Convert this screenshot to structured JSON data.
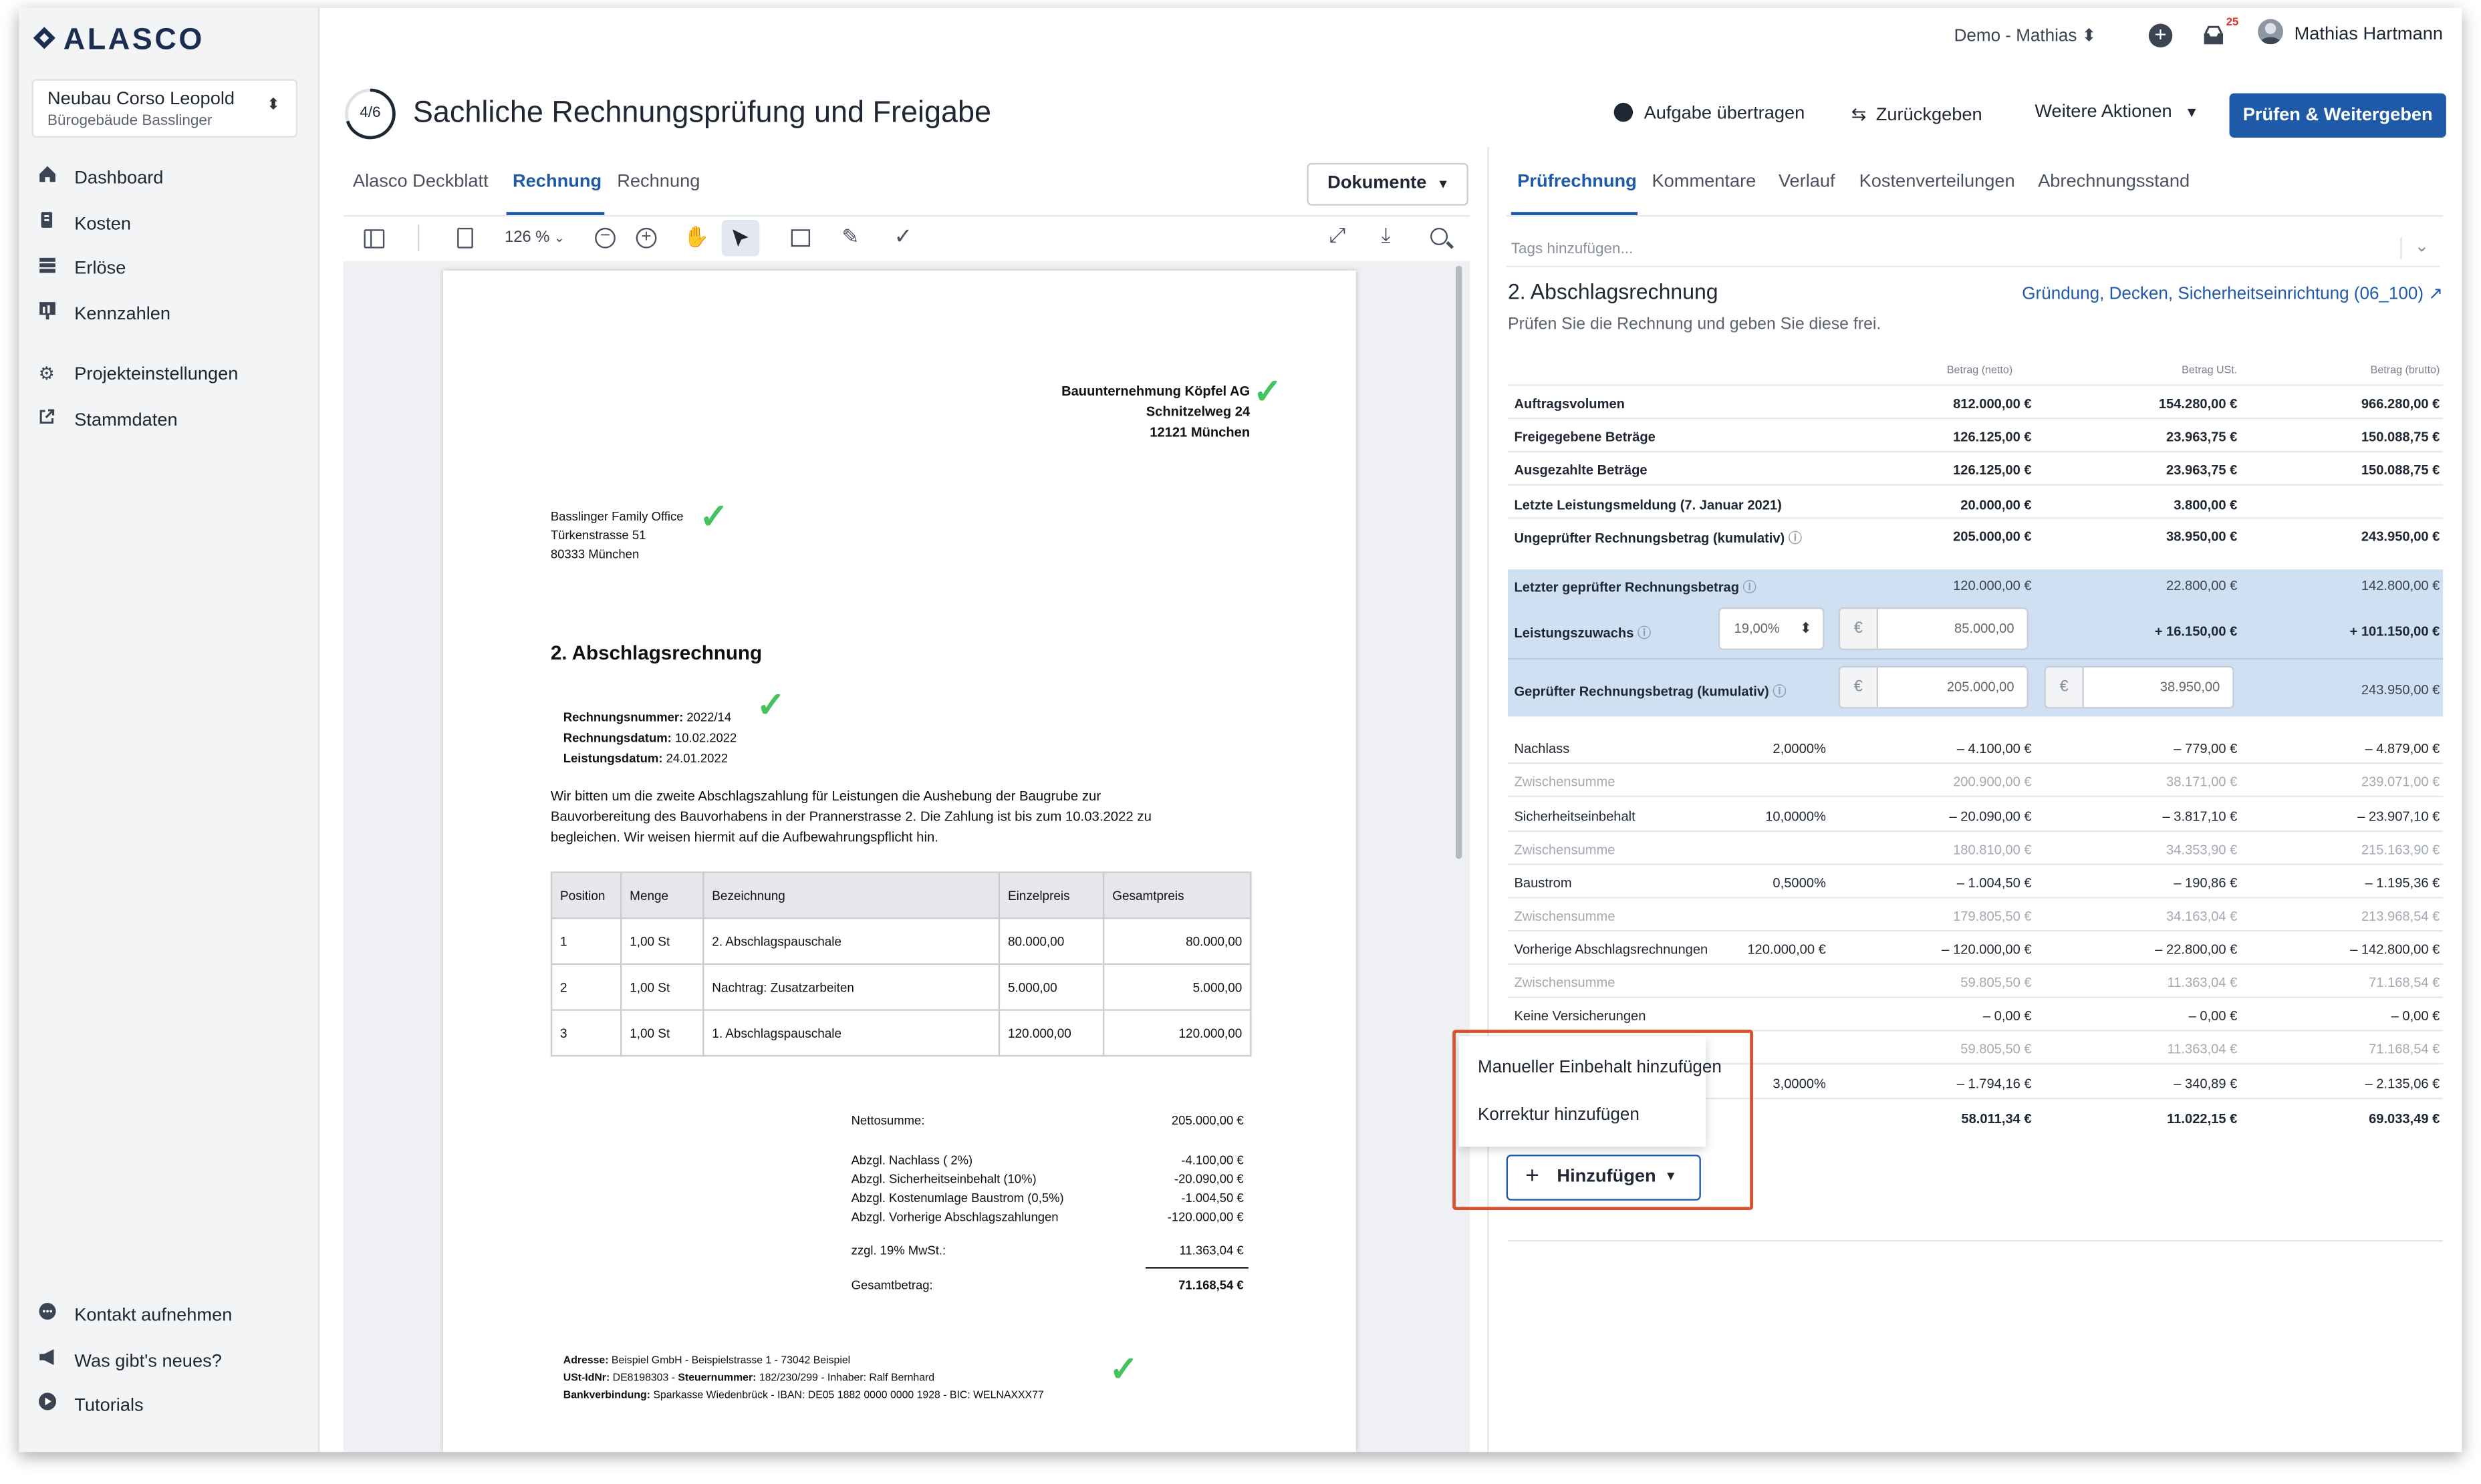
{
  "app": {
    "logo": "ALASCO"
  },
  "project": {
    "name": "Neubau Corso Leopold",
    "sub": "Bürogebäude Basslinger"
  },
  "sidebar": {
    "items": [
      {
        "label": "Dashboard",
        "icon": "home-icon"
      },
      {
        "label": "Kosten",
        "icon": "euro-icon"
      },
      {
        "label": "Erlöse",
        "icon": "revenue-icon"
      },
      {
        "label": "Kennzahlen",
        "icon": "chart-icon"
      },
      {
        "label": "Projekteinstellungen",
        "icon": "gear-icon"
      },
      {
        "label": "Stammdaten",
        "icon": "external-link-icon"
      }
    ],
    "bottom": [
      {
        "label": "Kontakt aufnehmen",
        "icon": "chat-icon"
      },
      {
        "label": "Was gibt's neues?",
        "icon": "megaphone-icon"
      },
      {
        "label": "Tutorials",
        "icon": "play-icon"
      }
    ]
  },
  "topbar": {
    "account": "Demo - Mathias",
    "notif_count": "25",
    "user": "Mathias Hartmann"
  },
  "header": {
    "step": "4/6",
    "title": "Sachliche Rechnungsprüfung und Freigabe",
    "transfer": "Aufgabe übertragen",
    "return": "Zurückgeben",
    "more": "Weitere Aktionen",
    "primary": "Prüfen & Weitergeben"
  },
  "doc_tabs": [
    "Alasco Deckblatt",
    "Rechnung",
    "Rechnung"
  ],
  "documents_btn": "Dokumente",
  "toolbar": {
    "zoom": "126 %"
  },
  "document": {
    "sender": [
      "Bauunternehmung Köpfel AG",
      "Schnitzelweg 24",
      "12121 München"
    ],
    "recipient": [
      "Basslinger Family Office",
      "Türkenstrasse 51",
      "80333 München"
    ],
    "title": "2. Abschlagsrechnung",
    "meta": [
      {
        "k": "Rechnungsnummer:",
        "v": "2022/14"
      },
      {
        "k": "Rechnungsdatum:",
        "v": "10.02.2022"
      },
      {
        "k": "Leistungsdatum:",
        "v": "24.01.2022"
      }
    ],
    "body": [
      "Wir bitten um die zweite Abschlagszahlung für Leistungen die Aushebung der Baugrube zur",
      "Bauvorbereitung des Bauvorhabens in der Prannerstrasse 2. Die Zahlung ist bis zum 10.03.2022 zu",
      "begleichen. Wir weisen hiermit auf die Aufbewahrungspflicht hin."
    ],
    "table_head": [
      "Position",
      "Menge",
      "Bezeichnung",
      "Einzelpreis",
      "Gesamtpreis"
    ],
    "table_rows": [
      [
        "1",
        "1,00 St",
        "2. Abschlagspauschale",
        "80.000,00",
        "80.000,00"
      ],
      [
        "2",
        "1,00 St",
        "Nachtrag: Zusatzarbeiten",
        "5.000,00",
        "5.000,00"
      ],
      [
        "3",
        "1,00 St",
        "1. Abschlagspauschale",
        "120.000,00",
        "120.000,00"
      ]
    ],
    "sums": {
      "net_label": "Nettosumme:",
      "net": "205.000,00 €",
      "d1_label": "Abzgl. Nachlass ( 2%)",
      "d1": "-4.100,00 €",
      "d2_label": "Abzgl. Sicherheitseinbehalt (10%)",
      "d2": "-20.090,00 €",
      "d3_label": "Abzgl. Kostenumlage Baustrom (0,5%)",
      "d3": "-1.004,50 €",
      "d4_label": "Abzgl. Vorherige Abschlagszahlungen",
      "d4": "-120.000,00 €",
      "vat_label": "zzgl. 19% MwSt.:",
      "vat": "11.363,04 €",
      "total_label": "Gesamtbetrag:",
      "total": "71.168,54 €"
    },
    "footer": [
      {
        "k": "Adresse:",
        "v": "Beispiel GmbH - Beispielstrasse 1 - 73042 Beispiel"
      },
      {
        "k": "USt-IdNr:",
        "v": "DE8198303 - ",
        "k2": "Steuernummer:",
        "v2": "182/230/299 - Inhaber: Ralf Bernhard"
      },
      {
        "k": "Bankverbindung:",
        "v": "Sparkasse Wiedenbrück - IBAN: DE05 1882 0000 0000 1928 - BIC: WELNAXXX77"
      }
    ]
  },
  "right_tabs": [
    "Prüfrechnung",
    "Kommentare",
    "Verlauf",
    "Kostenverteilungen",
    "Abrechnungsstand"
  ],
  "tags_placeholder": "Tags hinzufügen...",
  "invoice": {
    "title": "2. Abschlagsrechnung",
    "link": "Gründung, Decken, Sicherheitseinrichtung (06_100)",
    "subtitle": "Prüfen Sie die Rechnung und geben Sie diese frei."
  },
  "cols": [
    "Betrag (netto)",
    "Betrag USt.",
    "Betrag (brutto)"
  ],
  "summary_rows": [
    {
      "label": "Auftragsvolumen",
      "net": "812.000,00 €",
      "vat": "154.280,00 €",
      "gross": "966.280,00 €"
    },
    {
      "label": "Freigegebene Beträge",
      "net": "126.125,00 €",
      "vat": "23.963,75 €",
      "gross": "150.088,75 €"
    },
    {
      "label": "Ausgezahlte Beträge",
      "net": "126.125,00 €",
      "vat": "23.963,75 €",
      "gross": "150.088,75 €"
    },
    {
      "label": "Letzte Leistungsmeldung (7. Januar 2021)",
      "net": "20.000,00 €",
      "vat": "3.800,00 €",
      "gross": ""
    },
    {
      "label": "Ungeprüfter Rechnungsbetrag (kumulativ)",
      "net": "205.000,00 €",
      "vat": "38.950,00 €",
      "gross": "243.950,00 €"
    }
  ],
  "blue": {
    "r1": {
      "label": "Letzter geprüfter Rechnungsbetrag",
      "net": "120.000,00 €",
      "vat": "22.800,00 €",
      "gross": "142.800,00 €"
    },
    "r2": {
      "label": "Leistungszuwachs",
      "pct": "19,00%",
      "input": "85.000,00",
      "vat": "+ 16.150,00 €",
      "gross": "+ 101.150,00 €"
    },
    "r3": {
      "label": "Geprüfter Rechnungsbetrag (kumulativ)",
      "net_input": "205.000,00",
      "vat_input": "38.950,00",
      "gross": "243.950,00 €"
    },
    "currency": "€"
  },
  "deductions": [
    {
      "label": "Nachlass",
      "rate": "2,0000%",
      "net": "– 4.100,00 €",
      "vat": "– 779,00 €",
      "gross": "– 4.879,00 €",
      "sub": {
        "label": "Zwischensumme",
        "net": "200.900,00 €",
        "vat": "38.171,00 €",
        "gross": "239.071,00 €"
      }
    },
    {
      "label": "Sicherheitseinbehalt",
      "rate": "10,0000%",
      "net": "– 20.090,00 €",
      "vat": "– 3.817,10 €",
      "gross": "– 23.907,10 €",
      "sub": {
        "label": "Zwischensumme",
        "net": "180.810,00 €",
        "vat": "34.353,90 €",
        "gross": "215.163,90 €"
      }
    },
    {
      "label": "Baustrom",
      "rate": "0,5000%",
      "net": "– 1.004,50 €",
      "vat": "– 190,86 €",
      "gross": "– 1.195,36 €",
      "sub": {
        "label": "Zwischensumme",
        "net": "179.805,50 €",
        "vat": "34.163,04 €",
        "gross": "213.968,54 €"
      }
    },
    {
      "label": "Vorherige Abschlagsrechnungen",
      "rate": "120.000,00 €",
      "net": "– 120.000,00 €",
      "vat": "– 22.800,00 €",
      "gross": "– 142.800,00 €",
      "sub": {
        "label": "Zwischensumme",
        "net": "59.805,50 €",
        "vat": "11.363,04 €",
        "gross": "71.168,54 €"
      }
    },
    {
      "label": "Keine Versicherungen",
      "rate": "",
      "net": "– 0,00 €",
      "vat": "– 0,00 €",
      "gross": "– 0,00 €",
      "sub": {
        "label": "",
        "net": "59.805,50 €",
        "vat": "11.363,04 €",
        "gross": "71.168,54 €"
      }
    }
  ],
  "partial_row": {
    "rate": "3,0000%",
    "net": "– 1.794,16 €",
    "vat": "– 340,89 €",
    "gross": "– 2.135,06 €"
  },
  "total_row": {
    "net": "58.011,34 €",
    "vat": "11.022,15 €",
    "gross": "69.033,49 €"
  },
  "add_menu": {
    "items": [
      "Manueller Einbehalt hinzufügen",
      "Korrektur hinzufügen"
    ],
    "button": "Hinzufügen"
  },
  "colors": {
    "primary": "#1f5aa8",
    "highlight": "#cfe0f2",
    "check": "#46c25f",
    "callout": "#d9502f"
  }
}
